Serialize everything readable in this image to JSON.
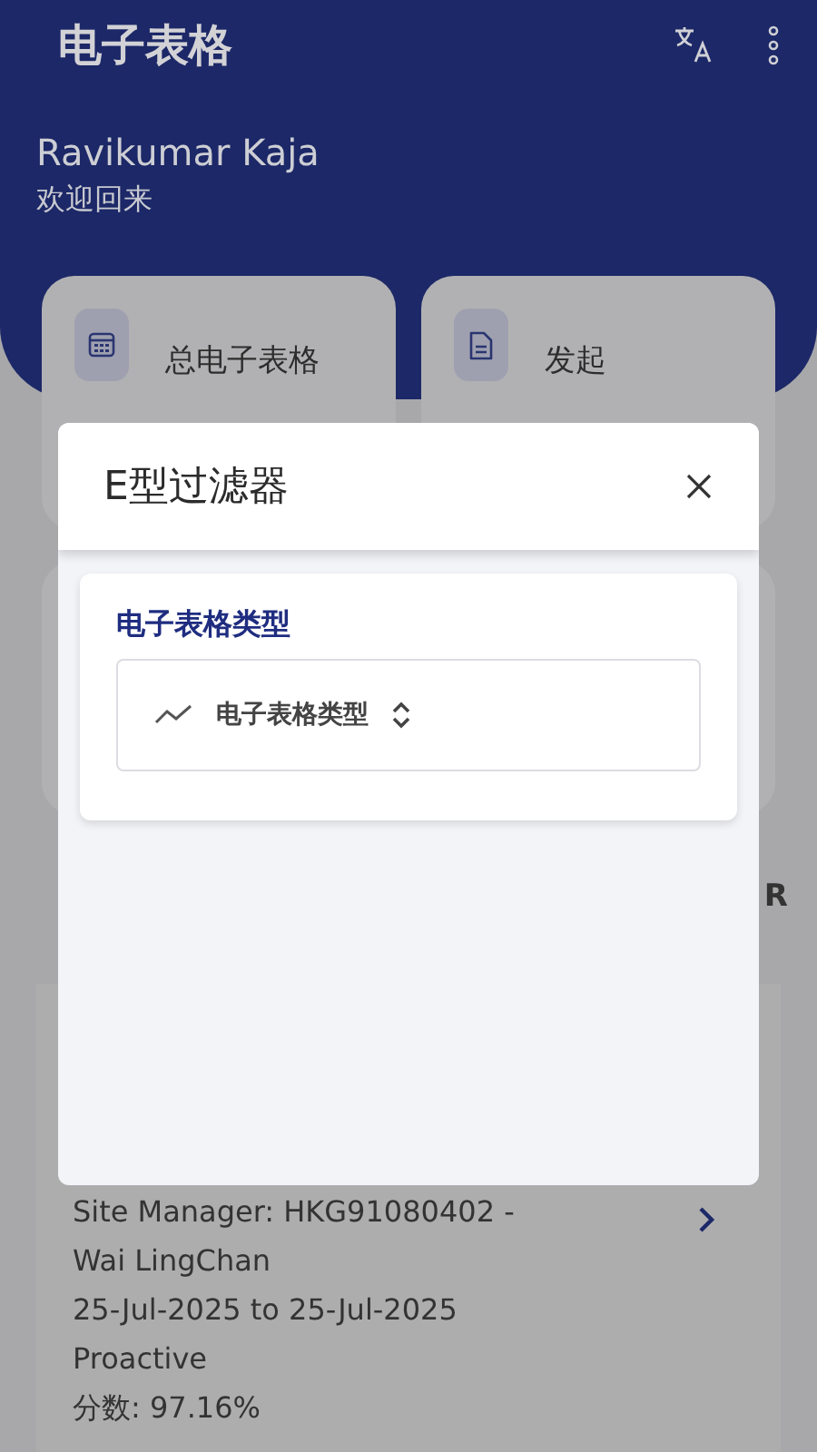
{
  "app_bar": {
    "title": "电子表格"
  },
  "user": {
    "name": "Ravikumar Kaja",
    "greeting": "欢迎回来"
  },
  "tiles": [
    {
      "label": "总电子表格",
      "kind": "calendar"
    },
    {
      "label": "发起",
      "kind": "document"
    }
  ],
  "section_fragment": "R",
  "report": {
    "lines": [
      "Site Manager: HKG91080402 - Wai LingChan",
      "25-Jul-2025 to 25-Jul-2025",
      "Proactive",
      "分数: 97.16%"
    ]
  },
  "dialog": {
    "title": "E型过滤器",
    "field_label": "电子表格类型",
    "select": {
      "value": "电子表格类型"
    }
  }
}
